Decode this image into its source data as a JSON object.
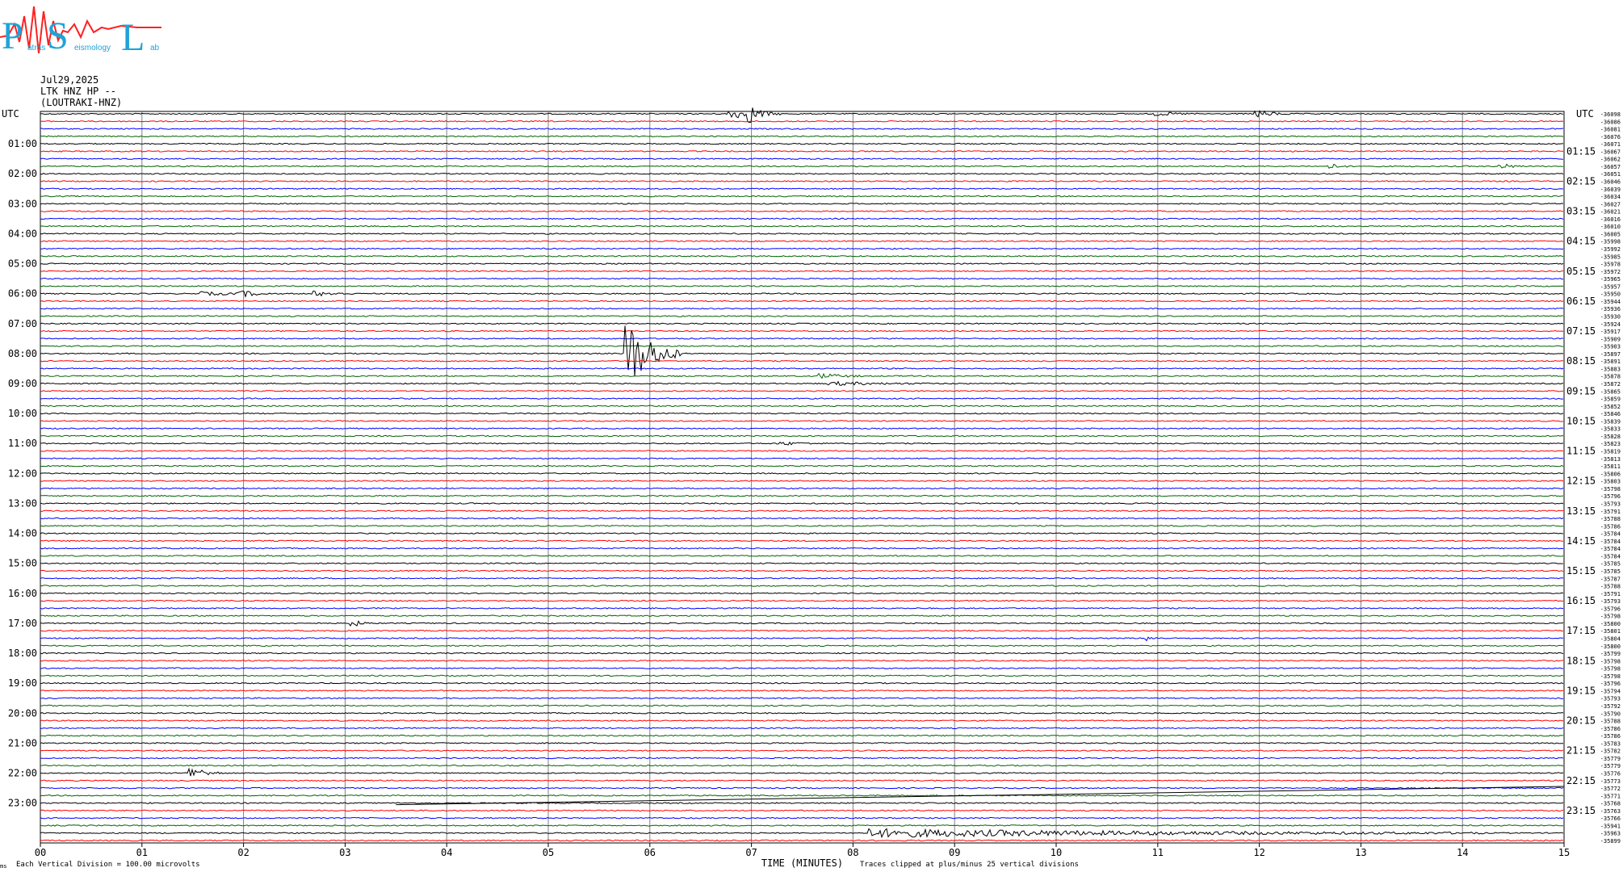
{
  "logo": {
    "big_letters": [
      "P",
      "S",
      "L"
    ],
    "small_words": [
      "atras",
      "eismology",
      "ab"
    ]
  },
  "header": {
    "date": "Jul29,2025",
    "station": "LTK HNZ HP --",
    "station_long": "(LOUTRAKI-HNZ)"
  },
  "labels": {
    "utc_left": "UTC",
    "utc_right": "UTC",
    "xlabel": "TIME (MINUTES)",
    "footer_left": "Each Vertical Division =  100.00 microvolts",
    "footer_right": "Traces clipped at plus/minus 25 vertical divisions",
    "corner_mark": "ms"
  },
  "colors": {
    "trace_cycle": [
      "#000000",
      "#ff0000",
      "#0000ff",
      "#006400"
    ],
    "grid": "#808080",
    "logo_blue": "#1fa3d8",
    "logo_red": "#ff2020"
  },
  "chart_data": {
    "type": "helicorder",
    "x_minutes": [
      "00",
      "01",
      "02",
      "03",
      "04",
      "05",
      "06",
      "07",
      "08",
      "09",
      "10",
      "11",
      "12",
      "13",
      "14",
      "15"
    ],
    "xlim": [
      0,
      15
    ],
    "rows_per_hour": 4,
    "left_hour_labels": [
      "01:00",
      "02:00",
      "03:00",
      "04:00",
      "05:00",
      "06:00",
      "07:00",
      "08:00",
      "09:00",
      "10:00",
      "11:00",
      "12:00",
      "13:00",
      "14:00",
      "15:00",
      "16:00",
      "17:00",
      "18:00",
      "19:00",
      "20:00",
      "21:00",
      "22:00",
      "23:00"
    ],
    "right_hour_labels": [
      "01:15",
      "02:15",
      "03:15",
      "04:15",
      "05:15",
      "06:15",
      "07:15",
      "08:15",
      "09:15",
      "10:15",
      "11:15",
      "12:15",
      "13:15",
      "14:15",
      "15:15",
      "16:15",
      "17:15",
      "18:15",
      "19:15",
      "20:15",
      "21:15",
      "22:15",
      "23:15"
    ],
    "row_offsets": [
      "-36098",
      "-36086",
      "-36081",
      "-36076",
      "-36071",
      "-36067",
      "-36062",
      "-36057",
      "-36051",
      "-36046",
      "-36039",
      "-36034",
      "-36027",
      "-36021",
      "-36016",
      "-36010",
      "-36005",
      "-35998",
      "-35992",
      "-35985",
      "-35978",
      "-35972",
      "-35965",
      "-35957",
      "-35950",
      "-35944",
      "-35936",
      "-35930",
      "-35924",
      "-35917",
      "-35909",
      "-35903",
      "-35897",
      "-35891",
      "-35883",
      "-35878",
      "-35872",
      "-35865",
      "-35859",
      "-35852",
      "-35846",
      "-35839",
      "-35833",
      "-35828",
      "-35823",
      "-35819",
      "-35813",
      "-35811",
      "-35806",
      "-35803",
      "-35798",
      "-35796",
      "-35793",
      "-35791",
      "-35788",
      "-35786",
      "-35784",
      "-35784",
      "-35784",
      "-35784",
      "-35785",
      "-35785",
      "-35787",
      "-35788",
      "-35791",
      "-35793",
      "-35796",
      "-35798",
      "-35800",
      "-35801",
      "-35804",
      "-35800",
      "-35799",
      "-35798",
      "-35798",
      "-35798",
      "-35796",
      "-35794",
      "-35793",
      "-35792",
      "-35790",
      "-35788",
      "-35786",
      "-35786",
      "-35783",
      "-35782",
      "-35779",
      "-35779",
      "-35776",
      "-35773",
      "-35772",
      "-35771",
      "-35768",
      "-35763",
      "-35766",
      "-35941",
      "-35963",
      "-35899"
    ],
    "events": [
      {
        "row": 0,
        "minute": 6.8,
        "amplitude": 6,
        "duration": 0.5
      },
      {
        "row": 0,
        "minute": 7.0,
        "amplitude": 8,
        "duration": 0.2
      },
      {
        "row": 0,
        "minute": 11.0,
        "amplitude": 2,
        "duration": 0.4
      },
      {
        "row": 0,
        "minute": 12.0,
        "amplitude": 4,
        "duration": 0.3
      },
      {
        "row": 7,
        "minute": 12.7,
        "amplitude": 3,
        "duration": 0.2
      },
      {
        "row": 7,
        "minute": 14.4,
        "amplitude": 3,
        "duration": 0.2
      },
      {
        "row": 24,
        "minute": 1.6,
        "amplitude": 2,
        "duration": 0.6
      },
      {
        "row": 24,
        "minute": 2.0,
        "amplitude": 3,
        "duration": 0.3
      },
      {
        "row": 24,
        "minute": 2.7,
        "amplitude": 3,
        "duration": 0.4
      },
      {
        "row": 32,
        "minute": 5.8,
        "amplitude": 40,
        "duration": 0.5
      },
      {
        "row": 35,
        "minute": 7.7,
        "amplitude": 3,
        "duration": 0.4
      },
      {
        "row": 36,
        "minute": 7.8,
        "amplitude": 2,
        "duration": 1.0
      },
      {
        "row": 44,
        "minute": 7.3,
        "amplitude": 2,
        "duration": 0.4
      },
      {
        "row": 70,
        "minute": 10.9,
        "amplitude": 3,
        "duration": 0.15
      },
      {
        "row": 68,
        "minute": 3.1,
        "amplitude": 3,
        "duration": 0.2
      },
      {
        "row": 88,
        "minute": 1.5,
        "amplitude": 7,
        "duration": 0.3
      },
      {
        "row": 96,
        "minute": 8.2,
        "amplitude": 5,
        "duration": 6.0
      }
    ]
  }
}
